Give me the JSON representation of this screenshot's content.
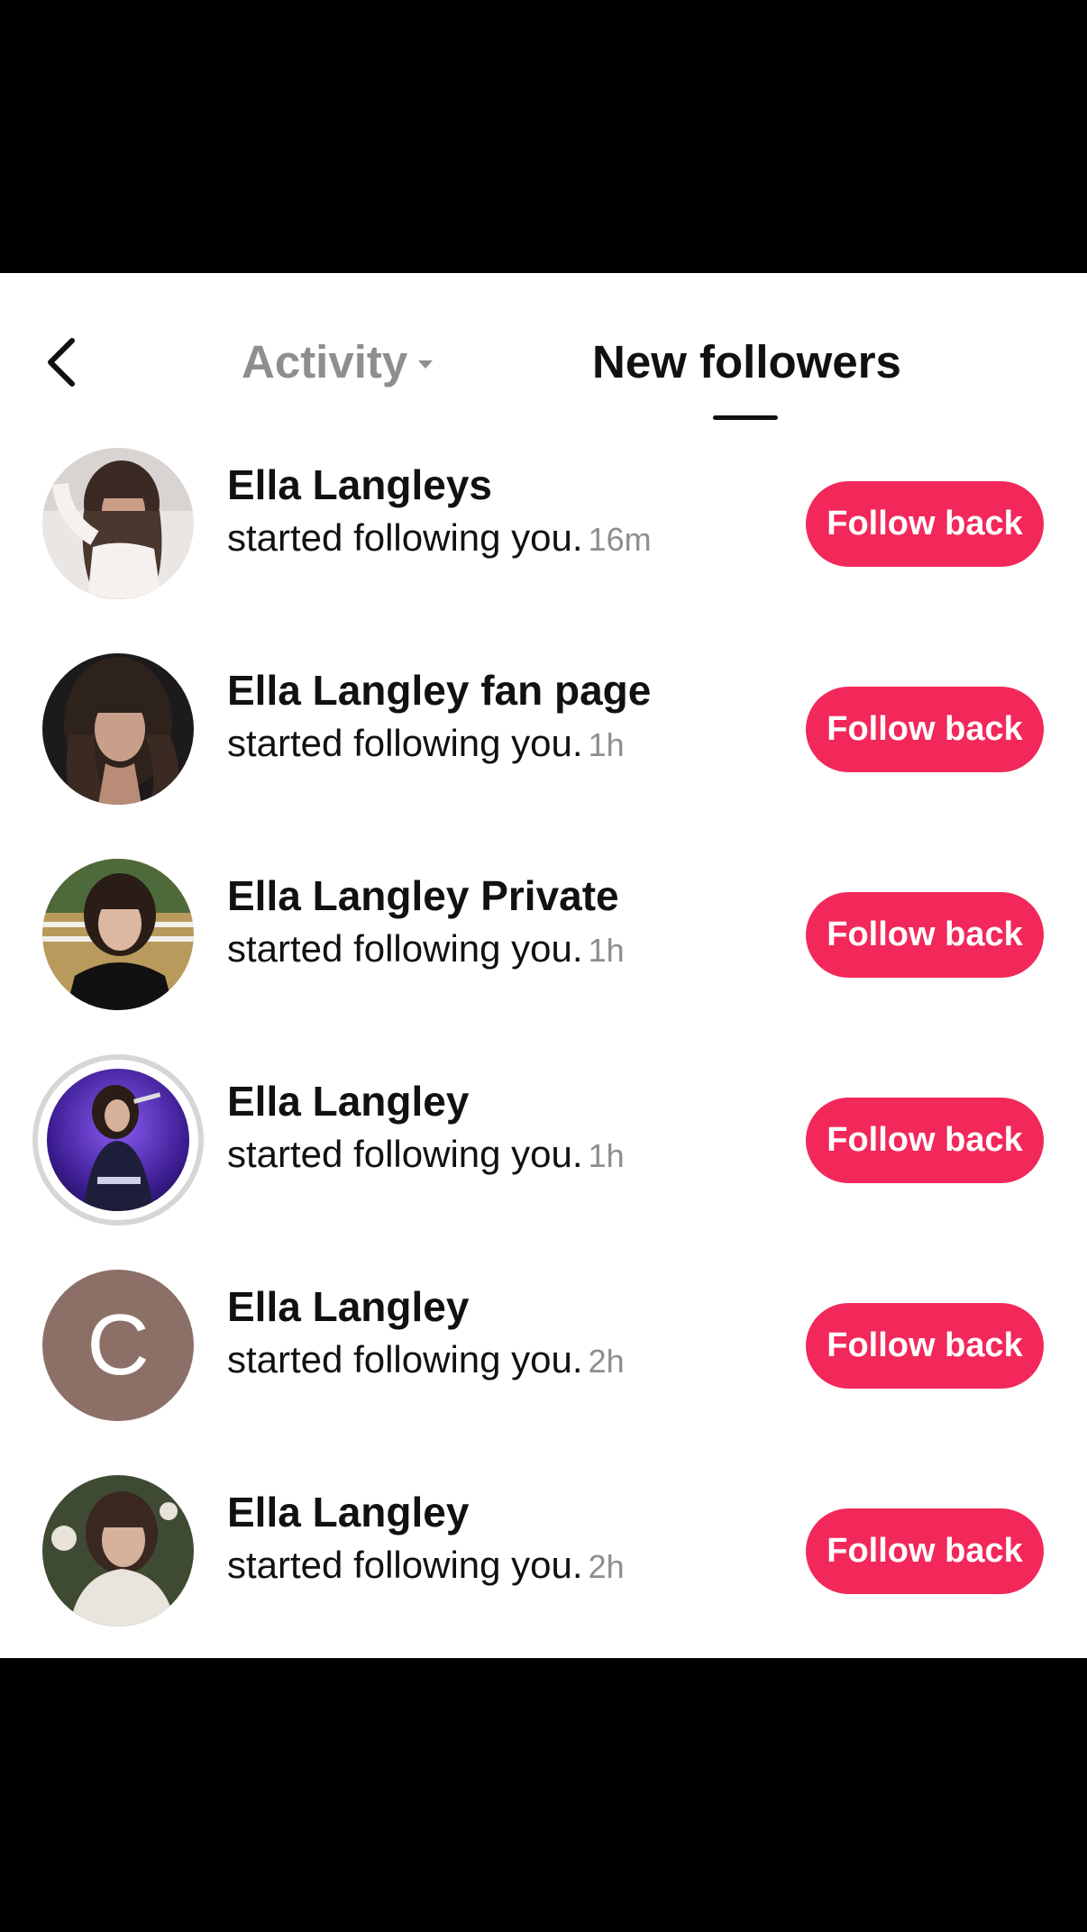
{
  "header": {
    "tabs": [
      {
        "label": "Activity",
        "active": false,
        "has_dropdown": true
      },
      {
        "label": "New followers",
        "active": true
      }
    ]
  },
  "followers": [
    {
      "name": "Ella Langleys",
      "action": "started following you.",
      "time": "16m",
      "button": "Follow back",
      "avatar": "photo"
    },
    {
      "name": "Ella Langley fan page",
      "action": "started following you.",
      "time": "1h",
      "button": "Follow back",
      "avatar": "photo"
    },
    {
      "name": "Ella Langley Private",
      "action": "started following you.",
      "time": "1h",
      "button": "Follow back",
      "avatar": "photo"
    },
    {
      "name": "Ella Langley",
      "action": "started following you.",
      "time": "1h",
      "button": "Follow back",
      "avatar": "photo-story-ring"
    },
    {
      "name": "Ella Langley",
      "action": "started following you.",
      "time": "2h",
      "button": "Follow back",
      "avatar": "letter",
      "avatar_letter": "C"
    },
    {
      "name": "Ella Langley",
      "action": "started following you.",
      "time": "2h",
      "button": "Follow back",
      "avatar": "photo"
    }
  ],
  "colors": {
    "accent": "#f2285a",
    "muted_text": "#8e8e8e",
    "letter_avatar_bg": "#8c7068"
  },
  "icons": {
    "back": "chevron-left-icon",
    "activity_dropdown": "caret-down-icon"
  }
}
